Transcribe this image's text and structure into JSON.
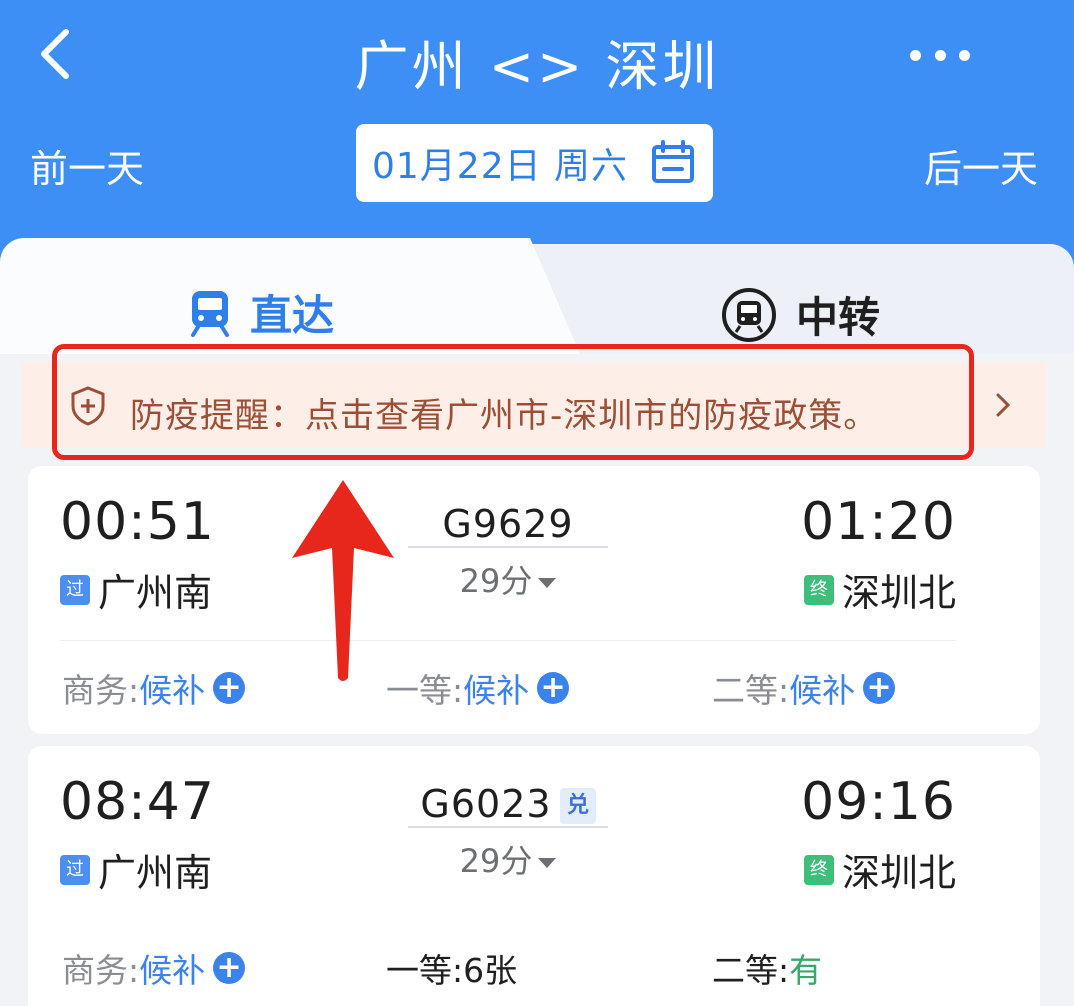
{
  "header": {
    "title": "广州 <> 深圳",
    "prev_day": "前一天",
    "next_day": "后一天",
    "date": "01月22日 周六",
    "icons": {
      "back": "back-chevron-icon",
      "more": "more-dots-icon",
      "calendar": "calendar-icon"
    },
    "colors": {
      "background": "#3d8ff6",
      "accent": "#2f7fea"
    }
  },
  "tabs": [
    {
      "label": "直达",
      "icon": "train-icon",
      "active": true
    },
    {
      "label": "中转",
      "icon": "transfer-train-icon",
      "active": false
    }
  ],
  "notice": {
    "text": "防疫提醒：点击查看广州市-深圳市的防疫政策。",
    "icon": "shield-plus-icon",
    "highlight_color": "#e8271c"
  },
  "trains": [
    {
      "departure_time": "00:51",
      "arrival_time": "01:20",
      "train_no": "G9629",
      "duration": "29分",
      "departure_station": "广州南",
      "departure_badge": "过",
      "arrival_station": "深圳北",
      "arrival_badge": "终",
      "tag": "",
      "seats": [
        {
          "label": "商务:",
          "value": "候补",
          "waitlist": true
        },
        {
          "label": "一等:",
          "value": "候补",
          "waitlist": true
        },
        {
          "label": "二等:",
          "value": "候补",
          "waitlist": true
        }
      ]
    },
    {
      "departure_time": "08:47",
      "arrival_time": "09:16",
      "train_no": "G6023",
      "duration": "29分",
      "departure_station": "广州南",
      "departure_badge": "过",
      "arrival_station": "深圳北",
      "arrival_badge": "终",
      "tag": "兑",
      "seats": [
        {
          "label": "商务:",
          "value": "候补",
          "waitlist": true
        },
        {
          "label": "一等:",
          "value": "6张",
          "waitlist": false
        },
        {
          "label": "二等:",
          "value": "有",
          "waitlist": false
        }
      ]
    }
  ],
  "annotation": {
    "icon": "red-arrow-up-icon",
    "color": "#e8271c"
  }
}
